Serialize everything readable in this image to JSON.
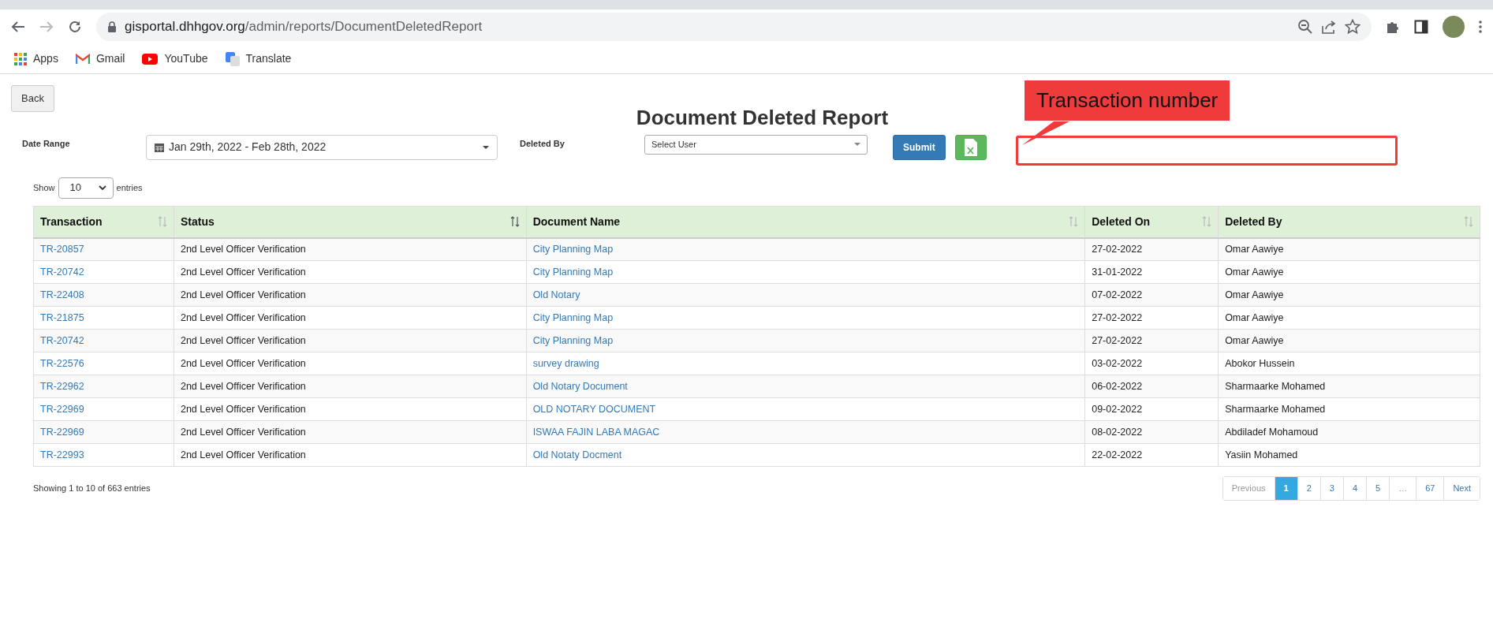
{
  "browser": {
    "url_host": "gisportal.dhhgov.org",
    "url_path": "/admin/reports/DocumentDeletedReport",
    "bookmarks": [
      {
        "label": "Apps",
        "kind": "apps"
      },
      {
        "label": "Gmail",
        "kind": "mail"
      },
      {
        "label": "YouTube",
        "kind": "video"
      },
      {
        "label": "Translate",
        "kind": "translate"
      }
    ]
  },
  "page": {
    "back_button": "Back",
    "title": "Document Deleted Report",
    "filters": {
      "date_range_label": "Date Range",
      "date_range_value": "Jan 29th, 2022 - Feb 28th, 2022",
      "deleted_by_label": "Deleted By",
      "deleted_by_placeholder": "Select User",
      "submit": "Submit"
    },
    "annotation": "Transaction number",
    "length": {
      "prefix": "Show",
      "value": "10",
      "suffix": "entries"
    },
    "table": {
      "columns": [
        {
          "label": "Transaction",
          "sorted": false
        },
        {
          "label": "Status",
          "sorted": true
        },
        {
          "label": "Document Name",
          "sorted": false
        },
        {
          "label": "Deleted On",
          "sorted": false
        },
        {
          "label": "Deleted By",
          "sorted": false
        }
      ],
      "rows": [
        [
          "TR-20857",
          "2nd Level Officer Verification",
          "City Planning Map",
          "27-02-2022",
          "Omar Aawiye"
        ],
        [
          "TR-20742",
          "2nd Level Officer Verification",
          "City Planning Map",
          "31-01-2022",
          "Omar Aawiye"
        ],
        [
          "TR-22408",
          "2nd Level Officer Verification",
          "Old Notary",
          "07-02-2022",
          "Omar Aawiye"
        ],
        [
          "TR-21875",
          "2nd Level Officer Verification",
          "City Planning Map",
          "27-02-2022",
          "Omar Aawiye"
        ],
        [
          "TR-20742",
          "2nd Level Officer Verification",
          "City Planning Map",
          "27-02-2022",
          "Omar Aawiye"
        ],
        [
          "TR-22576",
          "2nd Level Officer Verification",
          "survey drawing",
          "03-02-2022",
          "Abokor Hussein"
        ],
        [
          "TR-22962",
          "2nd Level Officer Verification",
          "Old Notary Document",
          "06-02-2022",
          "Sharmaarke Mohamed"
        ],
        [
          "TR-22969",
          "2nd Level Officer Verification",
          "OLD NOTARY DOCUMENT",
          "09-02-2022",
          "Sharmaarke Mohamed"
        ],
        [
          "TR-22969",
          "2nd Level Officer Verification",
          "ISWAA FAJIN LABA MAGAC",
          "08-02-2022",
          "Abdiladef Mohamoud"
        ],
        [
          "TR-22993",
          "2nd Level Officer Verification",
          "Old Notaty Docment",
          "22-02-2022",
          "Yasiin Mohamed"
        ]
      ]
    },
    "info": "Showing 1 to 10 of 663 entries",
    "pagination": [
      {
        "label": "Previous",
        "selected": false,
        "disabled": true
      },
      {
        "label": "1",
        "selected": true,
        "disabled": false
      },
      {
        "label": "2",
        "selected": false,
        "disabled": false
      },
      {
        "label": "3",
        "selected": false,
        "disabled": false
      },
      {
        "label": "4",
        "selected": false,
        "disabled": false
      },
      {
        "label": "5",
        "selected": false,
        "disabled": false
      },
      {
        "label": "…",
        "selected": false,
        "disabled": true
      },
      {
        "label": "67",
        "selected": false,
        "disabled": false
      },
      {
        "label": "Next",
        "selected": false,
        "disabled": false
      }
    ]
  }
}
